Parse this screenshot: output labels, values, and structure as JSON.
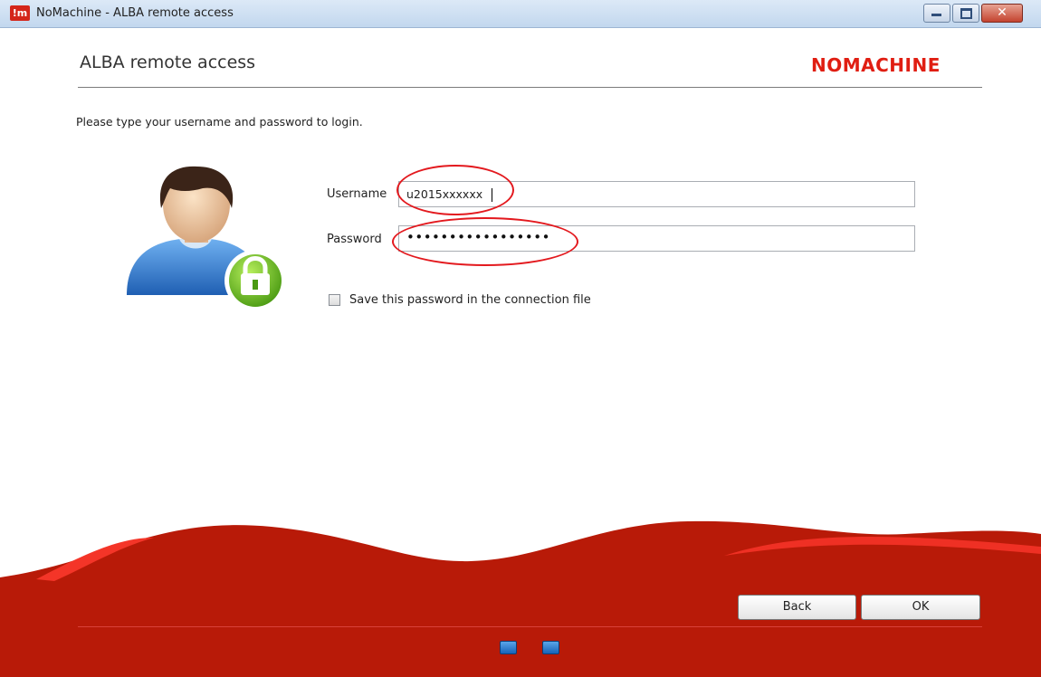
{
  "window": {
    "title": "NoMachine - ALBA remote access",
    "app_icon_text": "!m",
    "minimize_icon": "minimize-icon",
    "maximize_icon": "maximize-icon",
    "close_icon": "close-icon",
    "close_glyph": "✕"
  },
  "header": {
    "title": "ALBA remote access",
    "brand": "NOMACHINE"
  },
  "login": {
    "instructions": "Please type your username and password to login.",
    "avatar_icon": "user-lock-icon",
    "username_label": "Username",
    "username_value": "u2015xxxxxx",
    "password_label": "Password",
    "password_value": "•••••••••••••••••",
    "save_password_label": "Save this password in the connection file",
    "save_password_checked": false
  },
  "footer": {
    "back_label": "Back",
    "ok_label": "OK",
    "fullscreen_icon": "fullscreen-icon",
    "window_mode_icon": "window-mode-icon"
  },
  "colors": {
    "brand_red": "#e01e12",
    "banner_red": "#b81a08",
    "highlight_red": "#e3191e"
  }
}
